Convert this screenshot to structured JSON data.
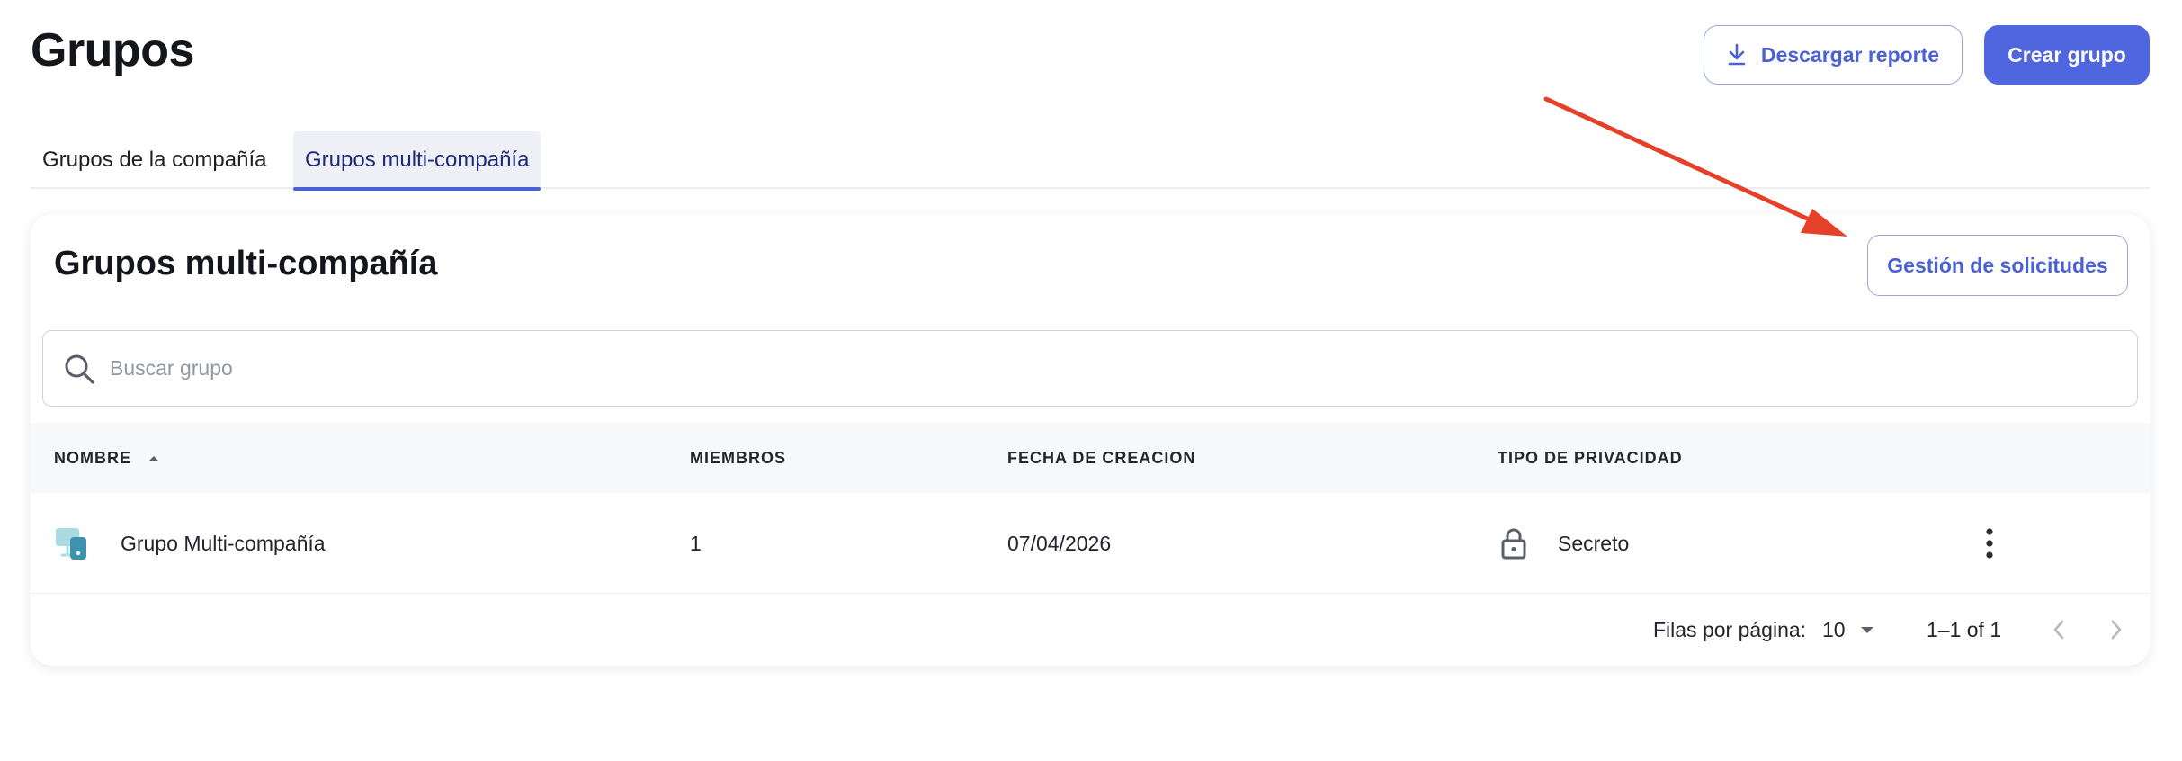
{
  "page": {
    "title": "Grupos",
    "download_button": {
      "label": "Descargar reporte",
      "icon": "download-icon"
    },
    "create_button": {
      "label": "Crear grupo"
    }
  },
  "tabs": [
    {
      "label": "Grupos de la compañía",
      "active": false
    },
    {
      "label": "Grupos multi-compañía",
      "active": true
    }
  ],
  "card": {
    "title": "Grupos multi-compañía",
    "requests_button": {
      "label": "Gestión de solicitudes"
    },
    "search": {
      "placeholder": "Buscar grupo",
      "icon": "search-icon"
    },
    "table": {
      "columns": [
        {
          "label": "NOMBRE",
          "sort": "ascending"
        },
        {
          "label": "MIEMBROS"
        },
        {
          "label": "FECHA DE CREACION"
        },
        {
          "label": "TIPO DE PRIVACIDAD"
        }
      ],
      "rows": [
        {
          "name": "Grupo Multi-compañía",
          "members": "1",
          "created": "07/04/2026",
          "privacy": "Secreto",
          "privacy_icon": "lock-icon",
          "group_icon": "group-screens-icon"
        }
      ]
    },
    "pagination": {
      "rows_per_page_label": "Filas por página:",
      "rows_per_page_value": "10",
      "range": "1–1 of 1"
    }
  },
  "annotation": {
    "color": "#e5412a",
    "icon": "red-arrow"
  },
  "colors": {
    "primary": "#5066de",
    "tab_active_bg": "#eef0f5",
    "header_bg": "#f7f8fa"
  }
}
